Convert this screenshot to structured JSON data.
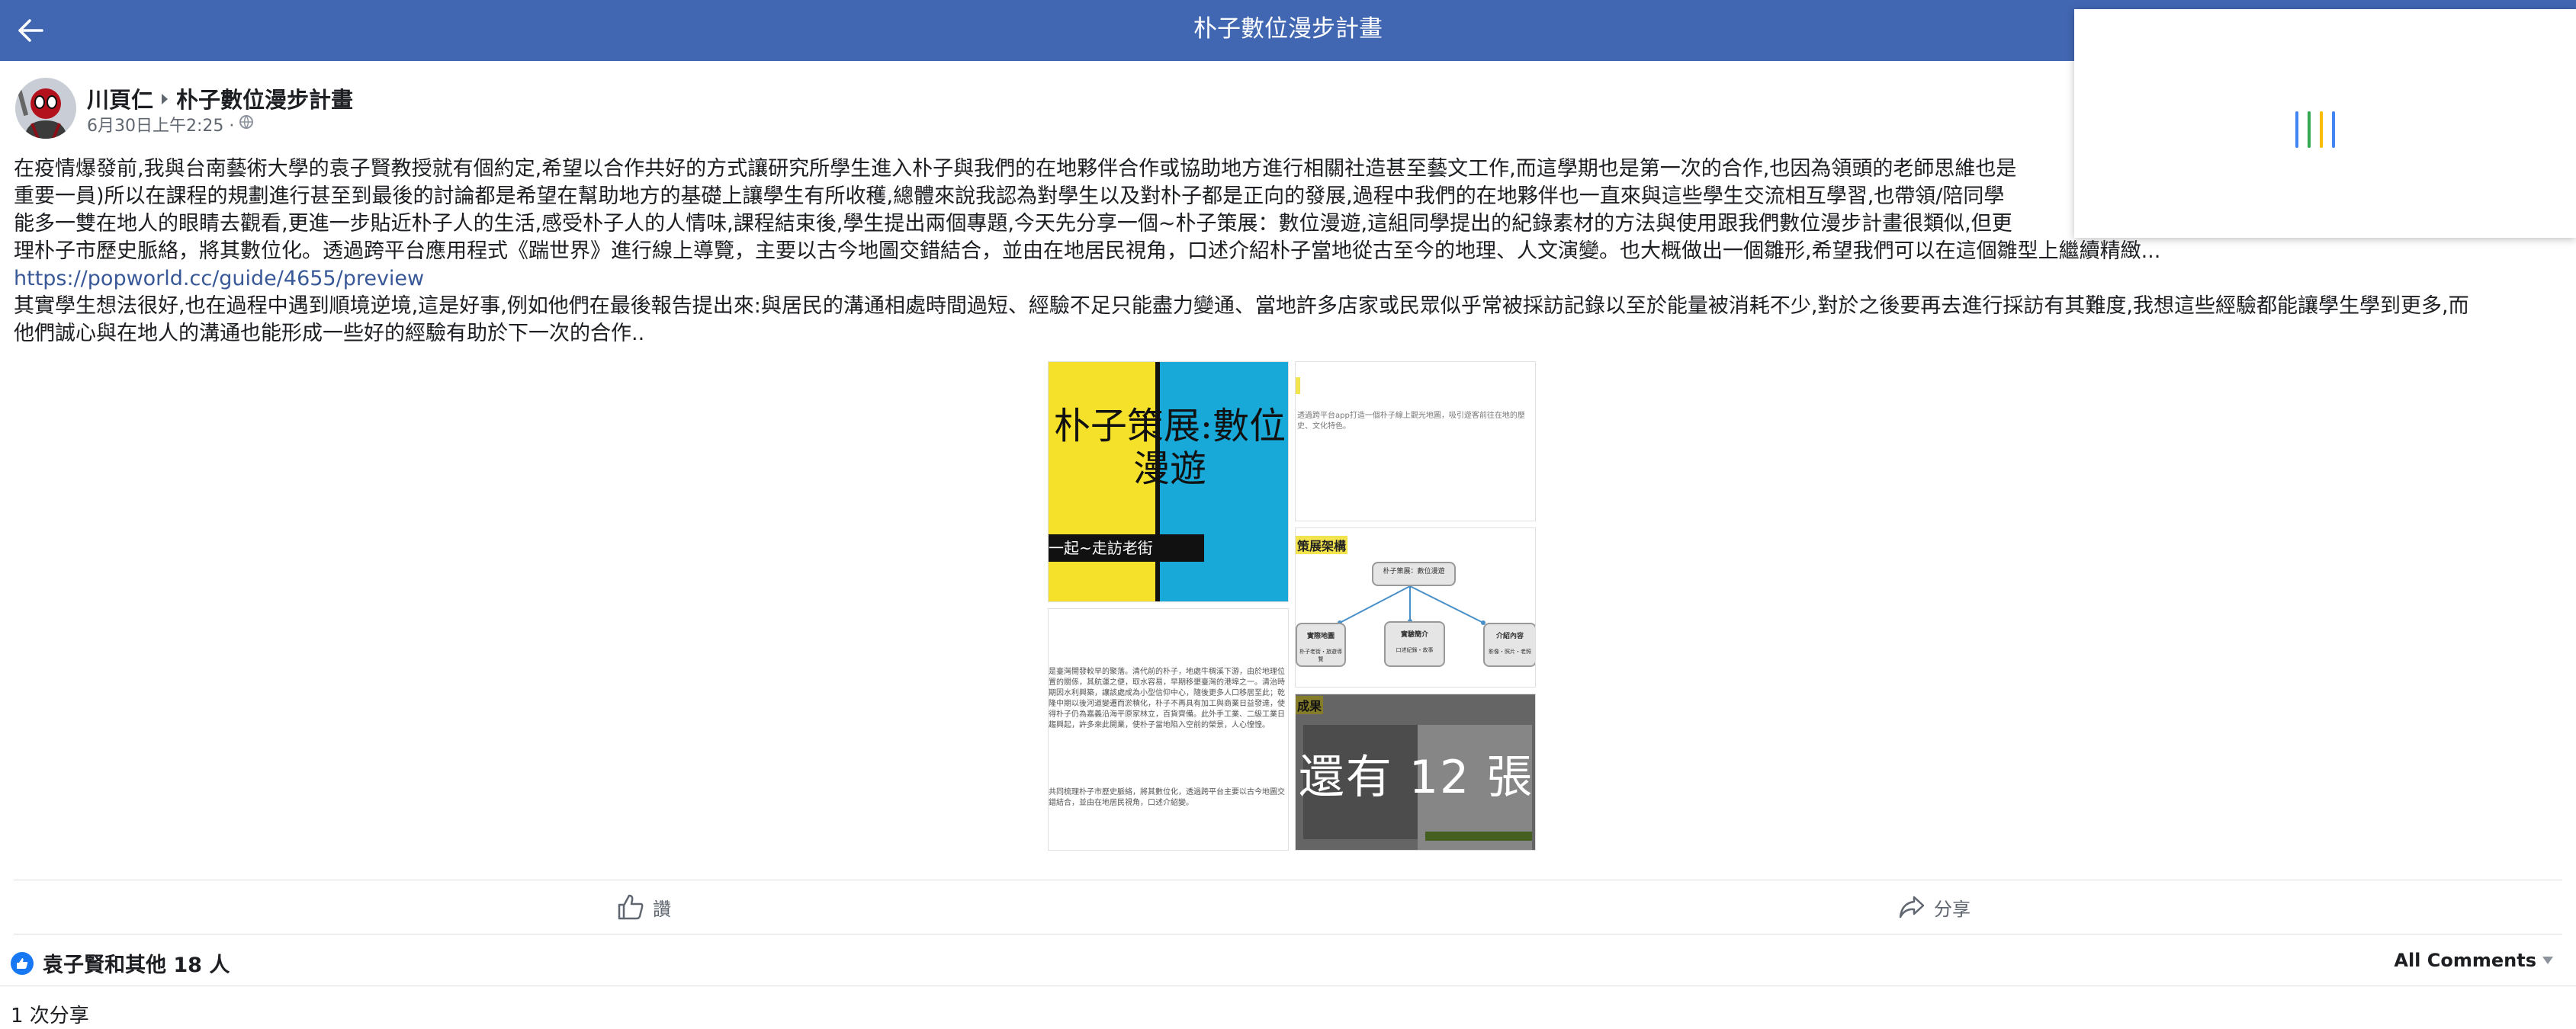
{
  "topbar": {
    "title": "朴子數位漫步計畫",
    "background": "#4267b2"
  },
  "post": {
    "author": "川頁仁",
    "group": "朴子數位漫步計畫",
    "timestamp": "6月30日上午2:25 ·",
    "body_line1": "在疫情爆發前,我與台南藝術大學的袁子賢教授就有個約定,希望以合作共好的方式讓研究所學生進入朴子與我們的在地夥伴合作或協助地方進行相關社造甚至藝文工作,而這學期也是第一次的合作,也因為領頭的老師思維也是",
    "body_line2": "重要一員)所以在課程的規劃進行甚至到最後的討論都是希望在幫助地方的基礎上讓學生有所收穫,總體來說我認為對學生以及對朴子都是正向的發展,過程中我們的在地夥伴也一直來與這些學生交流相互學習,也帶領/陪同學",
    "body_line3": "能多一雙在地人的眼睛去觀看,更進一步貼近朴子人的生活,感受朴子人的人情味,課程結束後,學生提出兩個專題,今天先分享一個~朴子策展：數位漫遊,這組同學提出的紀錄素材的方法與使用跟我們數位漫步計畫很類似,但更",
    "body_line4": "理朴子市歷史脈絡，將其數位化。透過跨平台應用程式《踹世界》進行線上導覽，主要以古今地圖交錯結合，並由在地居民視角，口述介紹朴子當地從古至今的地理、人文演變。也大概做出一個雛形,希望我們可以在這個雛型上繼續精緻...",
    "link": "https://popworld.cc/guide/4655/preview",
    "body_line5": "其實學生想法很好,也在過程中遇到順境逆境,這是好事,例如他們在最後報告提出來:與居民的溝通相處時間過短、經驗不足只能盡力變通、當地許多店家或民眾似乎常被採訪記錄以至於能量被消耗不少,對於之後要再去進行採訪有其難度,我想這些經驗都能讓學生學到更多,而",
    "body_line6": "他們誠心與在地人的溝通也能形成一些好的經驗有助於下一次的合作.."
  },
  "photos": {
    "cover_title": "朴子策展:數位漫遊",
    "cover_band": "一起~走訪老街",
    "cover_colors": [
      "#f5e12a",
      "#18a9d8"
    ],
    "tr_text": "透過跨平台app打造一個朴子線上觀光地圖，吸引遊客前往在地的歷史、文化特色。",
    "mr_tag": "策展架構",
    "diagram_root": "朴子策展：數位漫遊",
    "diagram_children": [
      "實際地圖",
      "實驗簡介",
      "介紹內容"
    ],
    "diagram_subs": [
      "朴子老街・旅遊導覽",
      "口述紀錄・故事",
      "影像・照片・老照"
    ],
    "ml_text1": "是臺灣開發較早的聚落。清代前的朴子，地處牛稠溪下游，由於地理位置的關係，其航運之便，取水容易，早期移墾臺灣的港埠之一。清治時期因水利興築，讓該處成為小型信仰中心，隨後更多人口移居至此；乾隆中期以後河道變遷而淤積化，朴子不再具有加工與商業日益發達，使得朴子仍為嘉義沿海平原家林立，百貨齊備。此外手工業、二級工業日趨興起，許多來此開業，使朴子當地陷入空前的榮景，人心惶惶。",
    "ml_text2": "共同梳理朴子市歷史脈絡，將其數位化，透過跨平台主要以古今地圖交錯結合，並由在地居民視角，口述介紹變。",
    "br_tag": "成果",
    "more_label": "還有 12 張"
  },
  "actions": {
    "like_label": "讚",
    "share_label": "分享"
  },
  "reactions": {
    "summary": "袁子賢和其他 18 人",
    "comments_sort": "All Comments",
    "shares": "1 次分享"
  },
  "loader_colors": [
    "#4285f4",
    "#34a853",
    "#fbbc05",
    "#ea4335"
  ]
}
